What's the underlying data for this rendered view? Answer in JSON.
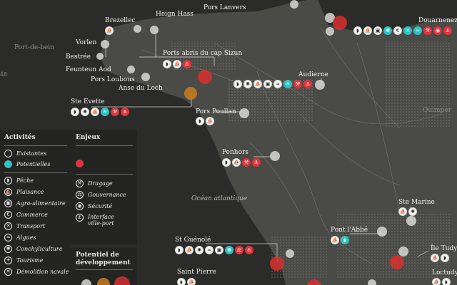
{
  "map": {
    "ocean_label": "Océan atlantique",
    "port_de_bein": "Port-de-bein",
    "edge_mark": "48",
    "quimper": "Quimper"
  },
  "places": {
    "brezellec": "Brezellec",
    "heign_hass": "Heign Hass",
    "pors_lanvers": "Pors Lanvers",
    "vorlen": "Vorlen",
    "bestree": "Bestrée",
    "feunteun_aod": "Feunteun Aod",
    "pors_loubous": "Pors Loubous",
    "anse_du_loch": "Anse du Loch",
    "ports_abris": "Ports abris du cap Sizun",
    "douarnenez": "Douarnenez",
    "audierne": "Audierne",
    "ste_evette": "Ste Evette",
    "pors_poullan": "Pors Poullan",
    "penhors": "Penhors",
    "ste_marine": "Ste Marine",
    "pont_labbe": "Pont l'Abbé",
    "st_guenole": "St Guénolé",
    "ile_tudy": "Île Tudy",
    "saint_pierre": "Saint Pierre",
    "loctudy": "Loctudy"
  },
  "legend": {
    "activites_title": "Activités",
    "existantes": "Existantes",
    "potentielles": "Potentielles",
    "peche": "Pêche",
    "plaisance": "Plaisance",
    "agro": "Agro-alimentaire",
    "commerce": "Commerce",
    "transport": "Transport",
    "algues": "Algues",
    "conchyliculture": "Conchyliculture",
    "tourisme": "Tourisme",
    "demolition": "Démolition navale",
    "enjeux_title": "Enjeux",
    "dragage": "Dragage",
    "gouvernance": "Gouvernance",
    "securite": "Sécurité",
    "interface": "Interface ville-port",
    "potentiel_title": "Potentiel de développement"
  },
  "colors": {
    "background": "#2b2b29",
    "land": "#4a4a47",
    "activity_existing": "#f4f4f2",
    "activity_potential": "#2fc3c1",
    "stake": "#e2343c",
    "potential_high": "#d6302e",
    "potential_mid": "#c87c1e",
    "potential_low": "#d7d7d4"
  },
  "icons": {
    "peche": "fish-icon",
    "plaisance": "sailboat-icon",
    "agro": "factory-icon",
    "commerce": "euro-icon",
    "transport": "ship-icon",
    "algues": "seaweed-icon",
    "conchyliculture": "shell-icon",
    "tourisme": "sun-icon",
    "demolition": "wrecking-icon",
    "dragage": "dredge-icon",
    "gouvernance": "gavel-icon",
    "securite": "lifebuoy-icon",
    "interface": "harbor-icon"
  }
}
